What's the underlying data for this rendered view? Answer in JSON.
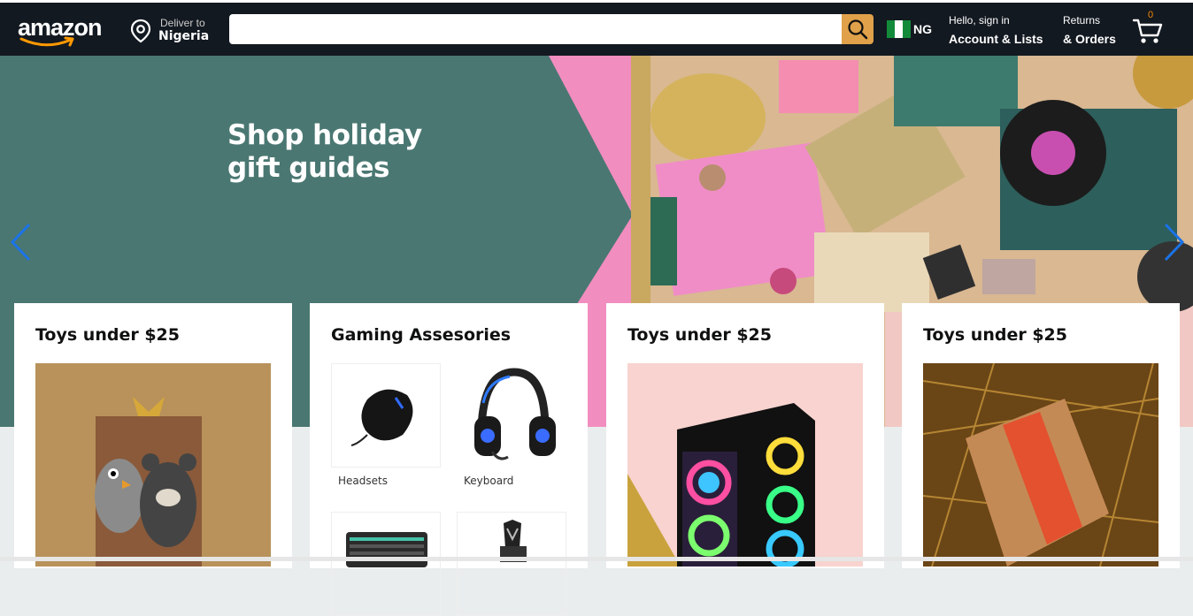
{
  "header": {
    "logo_text": "amazon",
    "deliver_to_label": "Deliver to",
    "deliver_to_country": "Nigeria",
    "search_placeholder": "",
    "search_value": "",
    "country_code": "NG",
    "account_greeting": "Hello, sign in",
    "account_label": "Account & Lists",
    "returns_line1": "Returns",
    "returns_line2": "& Orders",
    "cart_count": "0",
    "icons": [
      "location-pin-icon",
      "search-icon",
      "nigeria-flag-icon",
      "cart-icon"
    ]
  },
  "hero": {
    "title_line1": "Shop holiday",
    "title_line2": "gift guides",
    "icons": [
      "chevron-left-icon",
      "chevron-right-icon"
    ]
  },
  "cards": [
    {
      "title": "Toys under $25"
    },
    {
      "title": "Gaming Assesories",
      "items": [
        {
          "label": "Headsets"
        },
        {
          "label": "Keyboard"
        }
      ]
    },
    {
      "title": "Toys under $25"
    },
    {
      "title": "Toys under $25"
    }
  ],
  "colors": {
    "header_bg": "#131921",
    "search_button": "#e0a14a",
    "hero_teal": "#4a7772",
    "hero_pink": "#f28dbf",
    "arrow_blue": "#1a73e8",
    "cart_count": "#f08804"
  }
}
